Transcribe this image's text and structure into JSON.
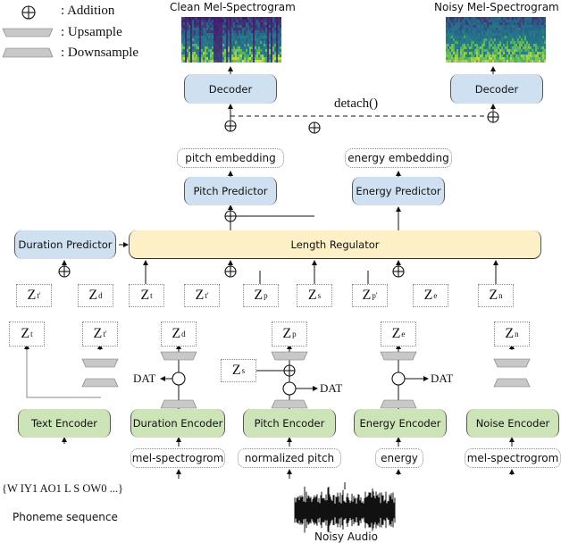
{
  "legend": {
    "addition": ": Addition",
    "upsample": ": Upsample",
    "downsample": ": Downsample"
  },
  "outputs": {
    "clean_title": "Clean Mel-Spectrogram",
    "noisy_title": "Noisy Mel-Spectrogram"
  },
  "decoders": {
    "clean": "Decoder",
    "noisy": "Decoder"
  },
  "detach_label": "detach()",
  "embeddings": {
    "pitch": "pitch embedding",
    "energy": "energy embedding"
  },
  "predictors": {
    "pitch": "Pitch Predictor",
    "energy": "Energy Predictor",
    "duration": "Duration Predictor"
  },
  "length_regulator": "Length Regulator",
  "z_row": [
    {
      "base": "Z",
      "sub": "t'"
    },
    {
      "base": "Z",
      "sub": "d"
    },
    {
      "base": "Z",
      "sub": "t"
    },
    {
      "base": "Z",
      "sub": "t'"
    },
    {
      "base": "Z",
      "sub": "p"
    },
    {
      "base": "Z",
      "sub": "s"
    },
    {
      "base": "Z",
      "sub": "p'"
    },
    {
      "base": "Z",
      "sub": "e"
    },
    {
      "base": "Z",
      "sub": "n"
    }
  ],
  "encoder_outputs": [
    {
      "base": "Z",
      "sub": "t"
    },
    {
      "base": "Z",
      "sub": "t'"
    },
    {
      "base": "Z",
      "sub": "d"
    },
    {
      "base": "Z",
      "sub": "p"
    },
    {
      "base": "Z",
      "sub": "e"
    },
    {
      "base": "Z",
      "sub": "n"
    }
  ],
  "speaker_input": {
    "base": "Z",
    "sub": "s"
  },
  "dat_label": "DAT",
  "encoders": {
    "text": "Text Encoder",
    "duration": "Duration Encoder",
    "pitch": "Pitch Encoder",
    "energy": "Energy Encoder",
    "noise": "Noise Encoder"
  },
  "inputs": {
    "duration": "mel-spectrogrom",
    "pitch": "normalized pitch",
    "energy": "energy",
    "noise": "mel-spectrogrom"
  },
  "phoneme": {
    "sequence": "{W IY1 AO1 L S OW0 ...}",
    "label": "Phoneme sequence"
  },
  "audio_label": "Noisy Audio",
  "colors": {
    "decoder_predictor_fill": "#cfe0f1",
    "encoder_fill": "#cde3b8",
    "length_regulator_fill": "#fdefc6",
    "sampler_fill": "#c8c8c8"
  }
}
